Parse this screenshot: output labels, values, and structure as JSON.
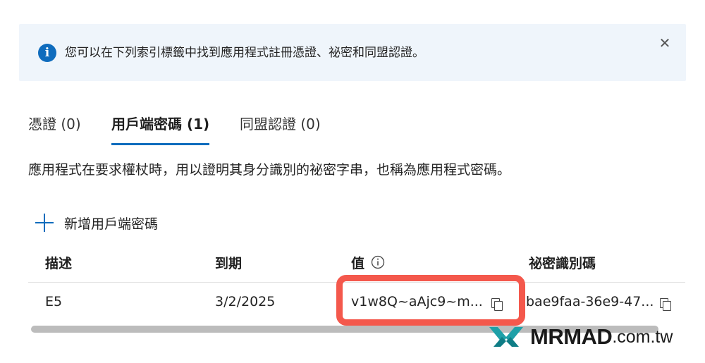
{
  "banner": {
    "info_icon": "info-icon",
    "message": "您可以在下列索引標籤中找到應用程式註冊憑證、祕密和同盟認證。",
    "close_icon": "close-icon"
  },
  "tabs": [
    {
      "label": "憑證 (0)",
      "active": false
    },
    {
      "label": "用戶端密碼 (1)",
      "active": true
    },
    {
      "label": "同盟認證 (0)",
      "active": false
    }
  ],
  "description": "應用程式在要求權杖時，用以證明其身分識別的祕密字串，也稱為應用程式密碼。",
  "toolbar": {
    "add_label": "新增用戶端密碼",
    "add_icon": "plus-icon"
  },
  "table": {
    "headers": [
      "描述",
      "到期",
      "值",
      "祕密識別碼"
    ],
    "value_info_icon": "info-icon",
    "rows": [
      {
        "description": "E5",
        "expires": "3/2/2025",
        "value": "v1w8Q~aAjc9~m...",
        "secret_id": "bae9faa-36e9-47..."
      }
    ]
  },
  "colors": {
    "accent": "#0f6cbd",
    "banner_bg": "#eff5fb",
    "highlight": "#f4584c"
  },
  "watermark": {
    "brand": "MRMAD",
    "domain": ".com.tw"
  }
}
